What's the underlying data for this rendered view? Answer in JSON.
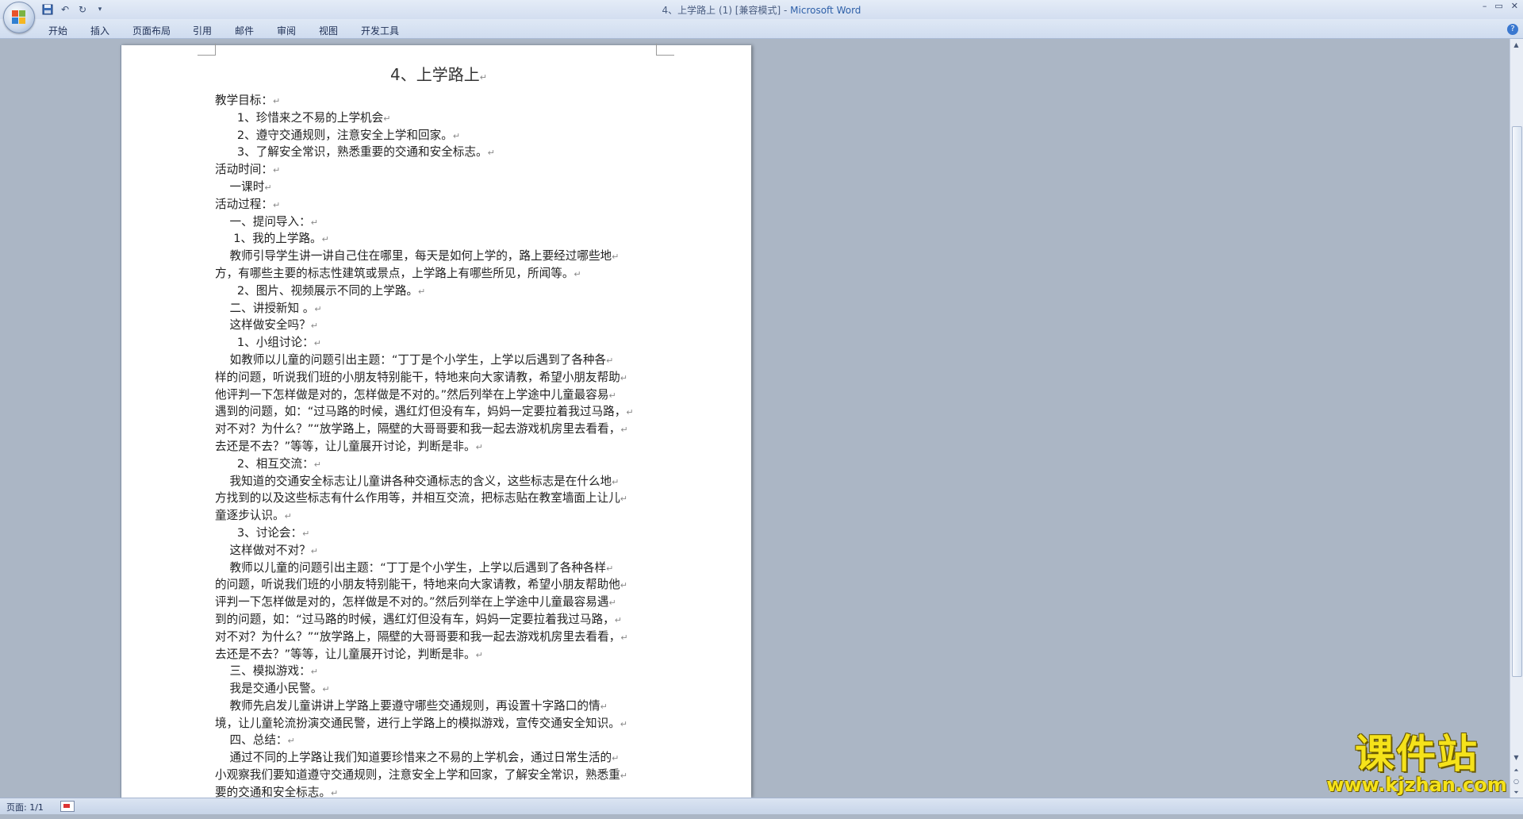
{
  "window": {
    "title_doc": "4、上学路上 (1) [兼容模式]",
    "title_sep": " - ",
    "title_app": "Microsoft Word",
    "min_glyph": "–",
    "max_glyph": "▭",
    "close_glyph": "✕"
  },
  "qat": {
    "save_icon": "save-icon",
    "undo_glyph": "↶",
    "redo_glyph": "↻",
    "customize_glyph": "▾"
  },
  "ribbon": {
    "tabs": [
      "开始",
      "插入",
      "页面布局",
      "引用",
      "邮件",
      "审阅",
      "视图",
      "开发工具"
    ],
    "help_glyph": "?"
  },
  "document": {
    "title": "4、上学路上",
    "paragraphs": [
      "教学目标：",
      "      1、珍惜来之不易的上学机会",
      "      2、遵守交通规则，注意安全上学和回家。",
      "      3、了解安全常识，熟悉重要的交通和安全标志。",
      "活动时间：",
      "    一课时",
      "活动过程：",
      "    一、提问导入：",
      "     1、我的上学路。",
      "    教师引导学生讲一讲自己住在哪里，每天是如何上学的，路上要经过哪些地",
      "方，有哪些主要的标志性建筑或景点，上学路上有哪些所见，所闻等。",
      "      2、图片、视频展示不同的上学路。",
      "    二、讲授新知 。",
      "    这样做安全吗？",
      "      1、小组讨论：",
      "    如教师以儿童的问题引出主题：“丁丁是个小学生，上学以后遇到了各种各",
      "样的问题，听说我们班的小朋友特别能干，特地来向大家请教，希望小朋友帮助",
      "他评判一下怎样做是对的，怎样做是不对的。”然后列举在上学途中儿童最容易",
      "遇到的问题，如：“过马路的时候，遇红灯但没有车，妈妈一定要拉着我过马路，",
      "对不对？为什么？”“放学路上，隔壁的大哥哥要和我一起去游戏机房里去看看，",
      "去还是不去？”等等，让儿童展开讨论，判断是非。",
      "      2、相互交流：",
      "    我知道的交通安全标志让儿童讲各种交通标志的含义，这些标志是在什么地",
      "方找到的以及这些标志有什么作用等，并相互交流，把标志贴在教室墙面上让儿",
      "童逐步认识。",
      "      3、讨论会：",
      "    这样做对不对？",
      "    教师以儿童的问题引出主题：“丁丁是个小学生，上学以后遇到了各种各样",
      "的问题，听说我们班的小朋友特别能干，特地来向大家请教，希望小朋友帮助他",
      "评判一下怎样做是对的，怎样做是不对的。”然后列举在上学途中儿童最容易遇",
      "到的问题，如：“过马路的时候，遇红灯但没有车，妈妈一定要拉着我过马路，",
      "对不对？为什么？”“放学路上，隔壁的大哥哥要和我一起去游戏机房里去看看，",
      "去还是不去？”等等，让儿童展开讨论，判断是非。",
      "    三、模拟游戏：",
      "    我是交通小民警。",
      "    教师先启发儿童讲讲上学路上要遵守哪些交通规则，再设置十字路口的情",
      "境，让儿童轮流扮演交通民警，进行上学路上的模拟游戏，宣传交通安全知识。",
      "    四、总结：",
      "    通过不同的上学路让我们知道要珍惜来之不易的上学机会，通过日常生活的",
      "小观察我们要知道遵守交通规则，注意安全上学和回家，了解安全常识，熟悉重",
      "要的交通和安全标志。",
      ""
    ],
    "para_mark": "↵"
  },
  "status": {
    "page_label": "页面: 1/1"
  },
  "watermark": {
    "text": "课件站",
    "url": "www.kjzhan.com"
  }
}
